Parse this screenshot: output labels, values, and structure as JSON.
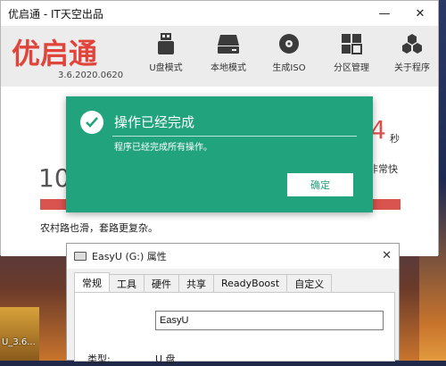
{
  "app": {
    "title": "优启通 - IT天空出品",
    "logo_text": "优启通",
    "version": "3.6.2020.0620",
    "nav": [
      {
        "label": "U盘模式",
        "icon": "usb-drive-icon"
      },
      {
        "label": "本地模式",
        "icon": "hard-disk-icon"
      },
      {
        "label": "生成ISO",
        "icon": "disc-icon"
      },
      {
        "label": "分区管理",
        "icon": "partition-grid-icon"
      },
      {
        "label": "关于程序",
        "icon": "hexagon-cluster-icon"
      }
    ],
    "big_number": "10",
    "countdown": "4",
    "countdown_unit": "秒",
    "speed_label": "非常快",
    "slogan": "农村路也滑，套路更复杂。",
    "progress": 1.0,
    "colors": {
      "accent": "#d9534f",
      "header_bg": "#ececec"
    }
  },
  "dialog": {
    "title": "操作已经完成",
    "message": "程序已经完成所有操作。",
    "ok_label": "确定",
    "bg_color": "#21a37d"
  },
  "props": {
    "title": "EasyU (G:) 属性",
    "tabs": [
      "常规",
      "工具",
      "硬件",
      "共享",
      "ReadyBoost",
      "自定义"
    ],
    "active_tab": "常规",
    "name_value": "EasyU",
    "type_label": "类型:",
    "type_value": "U 盘"
  },
  "desktop": {
    "icon_label": "U_3.6..."
  }
}
